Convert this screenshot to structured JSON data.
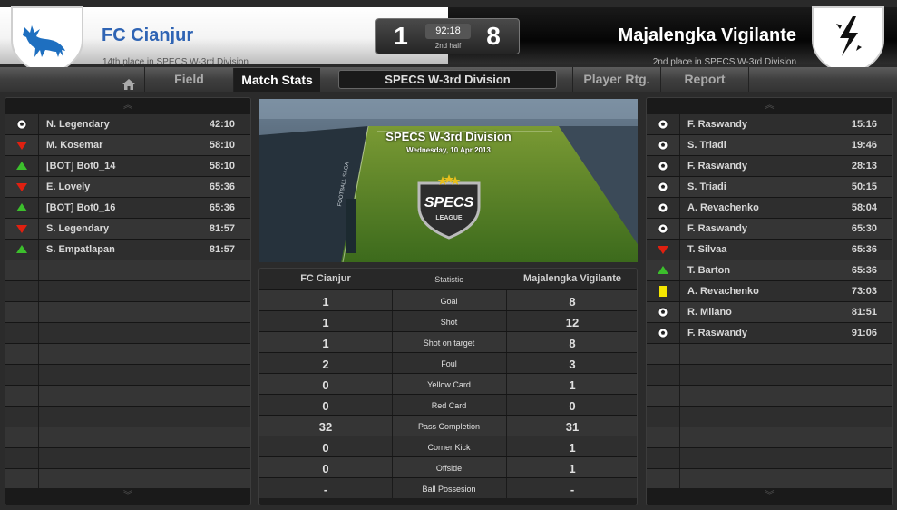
{
  "home": {
    "name": "FC Cianjur",
    "subtitle": "14th place in SPECS W-3rd Division",
    "score": "1"
  },
  "away": {
    "name": "Majalengka Vigilante",
    "subtitle": "2nd place in SPECS W-3rd Division",
    "score": "8"
  },
  "clock": {
    "time": "92:18",
    "period": "2nd half"
  },
  "nav": {
    "home_icon": "home-icon",
    "field": "Field",
    "match_stats": "Match Stats",
    "league": "SPECS W-3rd Division",
    "player_rating": "Player Rtg.",
    "report": "Report"
  },
  "stadium": {
    "title": "SPECS W-3rd Division",
    "date": "Wednesday, 10 Apr 2013",
    "logo_text": "SPECS",
    "logo_sub": "LEAGUE",
    "board_text": "FOOTBALL SAGA"
  },
  "home_events": [
    {
      "icon": "goal-ball-icon",
      "player": "N. Legendary",
      "time": "42:10"
    },
    {
      "icon": "sub-out-icon",
      "player": "M. Kosemar",
      "time": "58:10"
    },
    {
      "icon": "sub-in-icon",
      "player": "[BOT] Bot0_14",
      "time": "58:10"
    },
    {
      "icon": "sub-out-icon",
      "player": "E. Lovely",
      "time": "65:36"
    },
    {
      "icon": "sub-in-icon",
      "player": "[BOT] Bot0_16",
      "time": "65:36"
    },
    {
      "icon": "sub-out-icon",
      "player": "S. Legendary",
      "time": "81:57"
    },
    {
      "icon": "sub-in-icon",
      "player": "S. Empatlapan",
      "time": "81:57"
    }
  ],
  "away_events": [
    {
      "icon": "goal-ball-icon",
      "player": "F. Raswandy",
      "time": "15:16"
    },
    {
      "icon": "goal-ball-icon",
      "player": "S. Triadi",
      "time": "19:46"
    },
    {
      "icon": "goal-ball-icon",
      "player": "F. Raswandy",
      "time": "28:13"
    },
    {
      "icon": "goal-ball-icon",
      "player": "S. Triadi",
      "time": "50:15"
    },
    {
      "icon": "goal-ball-icon",
      "player": "A. Revachenko",
      "time": "58:04"
    },
    {
      "icon": "goal-ball-icon",
      "player": "F. Raswandy",
      "time": "65:30"
    },
    {
      "icon": "sub-out-icon",
      "player": "T. Silvaa",
      "time": "65:36"
    },
    {
      "icon": "sub-in-icon",
      "player": "T. Barton",
      "time": "65:36"
    },
    {
      "icon": "yellow-card-icon",
      "player": "A. Revachenko",
      "time": "73:03"
    },
    {
      "icon": "goal-ball-icon",
      "player": "R. Milano",
      "time": "81:51"
    },
    {
      "icon": "goal-ball-icon",
      "player": "F. Raswandy",
      "time": "91:06"
    }
  ],
  "stats": {
    "headers": {
      "home": "FC Cianjur",
      "label": "Statistic",
      "away": "Majalengka Vigilante"
    },
    "rows": [
      {
        "label": "Goal",
        "home": "1",
        "away": "8"
      },
      {
        "label": "Shot",
        "home": "1",
        "away": "12"
      },
      {
        "label": "Shot on target",
        "home": "1",
        "away": "8"
      },
      {
        "label": "Foul",
        "home": "2",
        "away": "3"
      },
      {
        "label": "Yellow Card",
        "home": "0",
        "away": "1"
      },
      {
        "label": "Red Card",
        "home": "0",
        "away": "0"
      },
      {
        "label": "Pass Completion",
        "home": "32",
        "away": "31"
      },
      {
        "label": "Corner Kick",
        "home": "0",
        "away": "1"
      },
      {
        "label": "Offside",
        "home": "0",
        "away": "1"
      },
      {
        "label": "Ball Possesion",
        "home": "-",
        "away": "-"
      }
    ]
  },
  "colors": {
    "home_accent": "#2f64b4",
    "sub_in": "#3cbf2c",
    "sub_out": "#e02010",
    "yellow_card": "#f5e600"
  }
}
